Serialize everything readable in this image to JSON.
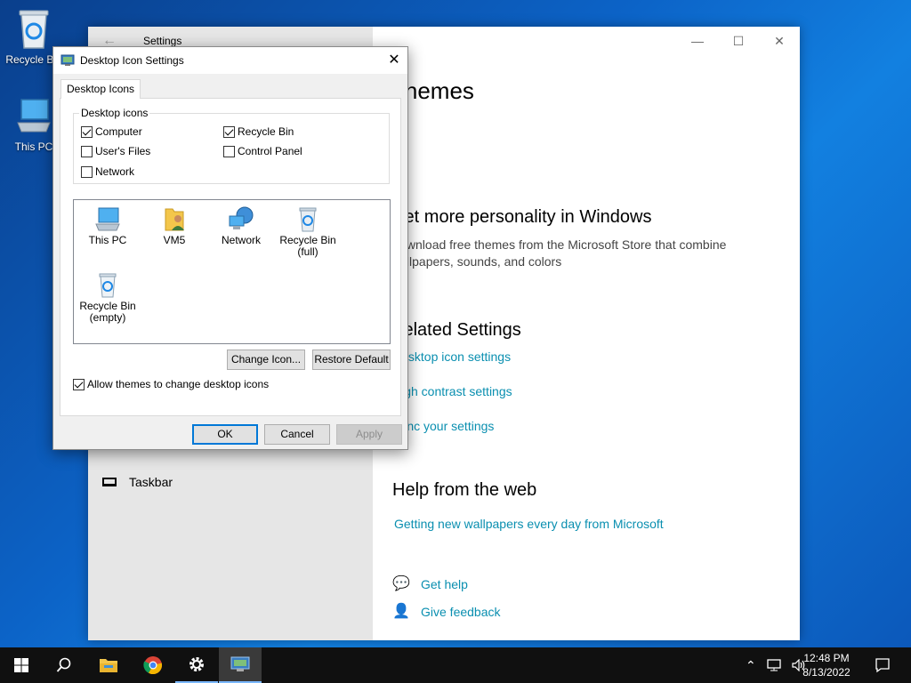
{
  "desktop": {
    "icons": [
      {
        "label": "Recycle Bin",
        "icon": "recycle-bin-icon"
      },
      {
        "label": "This PC",
        "icon": "this-pc-icon"
      }
    ]
  },
  "settings_window": {
    "title": "Settings",
    "left_nav": {
      "taskbar_label": "Taskbar"
    },
    "page_heading": "Themes",
    "personality": {
      "heading": "Get more personality in Windows",
      "description": "Download free themes from the Microsoft Store that combine wallpapers, sounds, and colors"
    },
    "related": {
      "heading": "Related Settings",
      "links": [
        "Desktop icon settings",
        "High contrast settings",
        "Sync your settings"
      ]
    },
    "help_web": {
      "heading": "Help from the web",
      "link": "Getting new wallpapers every day from Microsoft"
    },
    "get_help": "Get help",
    "give_feedback": "Give feedback"
  },
  "dialog": {
    "title": "Desktop Icon Settings",
    "tab": "Desktop Icons",
    "group_label": "Desktop icons",
    "checkboxes": [
      {
        "label": "Computer",
        "checked": true
      },
      {
        "label": "Recycle Bin",
        "checked": true
      },
      {
        "label": "User's Files",
        "checked": false
      },
      {
        "label": "Control Panel",
        "checked": false
      },
      {
        "label": "Network",
        "checked": false
      }
    ],
    "icon_list": [
      {
        "label": "This PC",
        "icon": "this-pc-icon"
      },
      {
        "label": "VM5",
        "icon": "user-folder-icon"
      },
      {
        "label": "Network",
        "icon": "network-icon"
      },
      {
        "label": "Recycle Bin (full)",
        "icon": "recycle-bin-full-icon"
      },
      {
        "label": "Recycle Bin (empty)",
        "icon": "recycle-bin-empty-icon"
      }
    ],
    "change_icon": "Change Icon...",
    "restore_default": "Restore Default",
    "allow_themes": {
      "label": "Allow themes to change desktop icons",
      "checked": true
    },
    "ok": "OK",
    "cancel": "Cancel",
    "apply": "Apply"
  },
  "taskbar": {
    "clock_time": "12:48 PM",
    "clock_date": "8/13/2022"
  }
}
